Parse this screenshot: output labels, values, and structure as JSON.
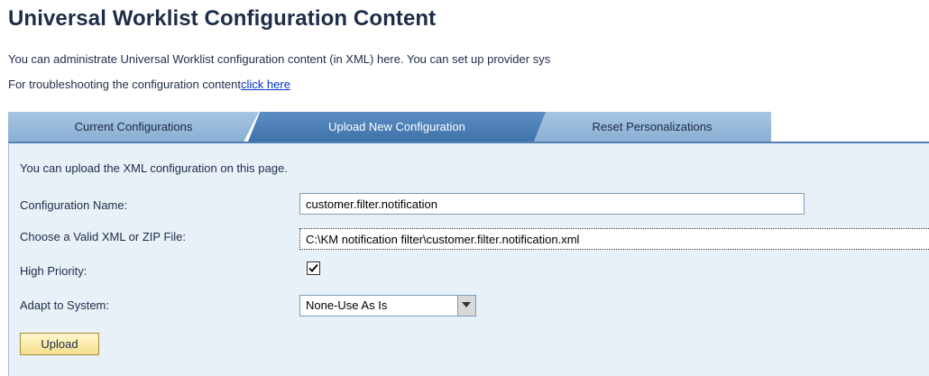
{
  "header": {
    "title": "Universal Worklist Configuration Content",
    "description": "You can administrate Universal Worklist configuration content (in XML) here. You can set up provider sys",
    "troubleshoot_text": "For troubleshooting the configuration content",
    "troubleshoot_link": "click here"
  },
  "tabs": [
    {
      "label": "Current Configurations",
      "active": false
    },
    {
      "label": "Upload New Configuration",
      "active": true
    },
    {
      "label": "Reset Personalizations",
      "active": false
    }
  ],
  "form": {
    "intro": "You can upload the XML configuration on this page.",
    "config_name_label": "Configuration Name:",
    "config_name_value": "customer.filter.notification",
    "file_label": "Choose a Valid XML or ZIP File:",
    "file_value": "C:\\KM notification filter\\customer.filter.notification.xml",
    "priority_label": "High Priority:",
    "priority_checked": true,
    "adapt_label": "Adapt to System:",
    "adapt_value": "None-Use As Is",
    "upload_label": "Upload"
  },
  "colors": {
    "title": "#1d2c48",
    "tab_active": "#4f81b6",
    "tab_inactive": "#8fb3d6",
    "panel_bg": "#e8f0f8",
    "link": "#0033cc",
    "button_bg": "#fdf0b8"
  }
}
